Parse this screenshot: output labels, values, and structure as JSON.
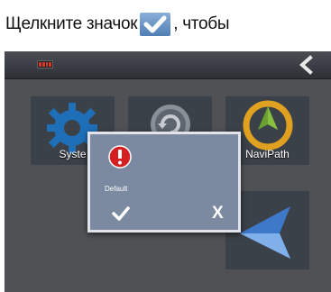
{
  "instruction": {
    "before_icon": "Щелкните значок",
    "after_icon": ", чтобы"
  },
  "tiles": {
    "system_label": "Syste",
    "navipath_label": "NaviPath"
  },
  "dialog": {
    "message": "Default",
    "cancel_label": "X"
  },
  "colors": {
    "dialog_bg": "#7b8aa0",
    "battery_fill": "#d63a2a",
    "navipath_ring": "#e0a020",
    "arrow_blue": "#3e78c8"
  },
  "icons": [
    "checkmark-icon",
    "battery-icon",
    "back-chevron-icon",
    "gear-icon",
    "refresh-icon",
    "navipath-icon",
    "alert-icon",
    "nav-arrow-icon"
  ]
}
